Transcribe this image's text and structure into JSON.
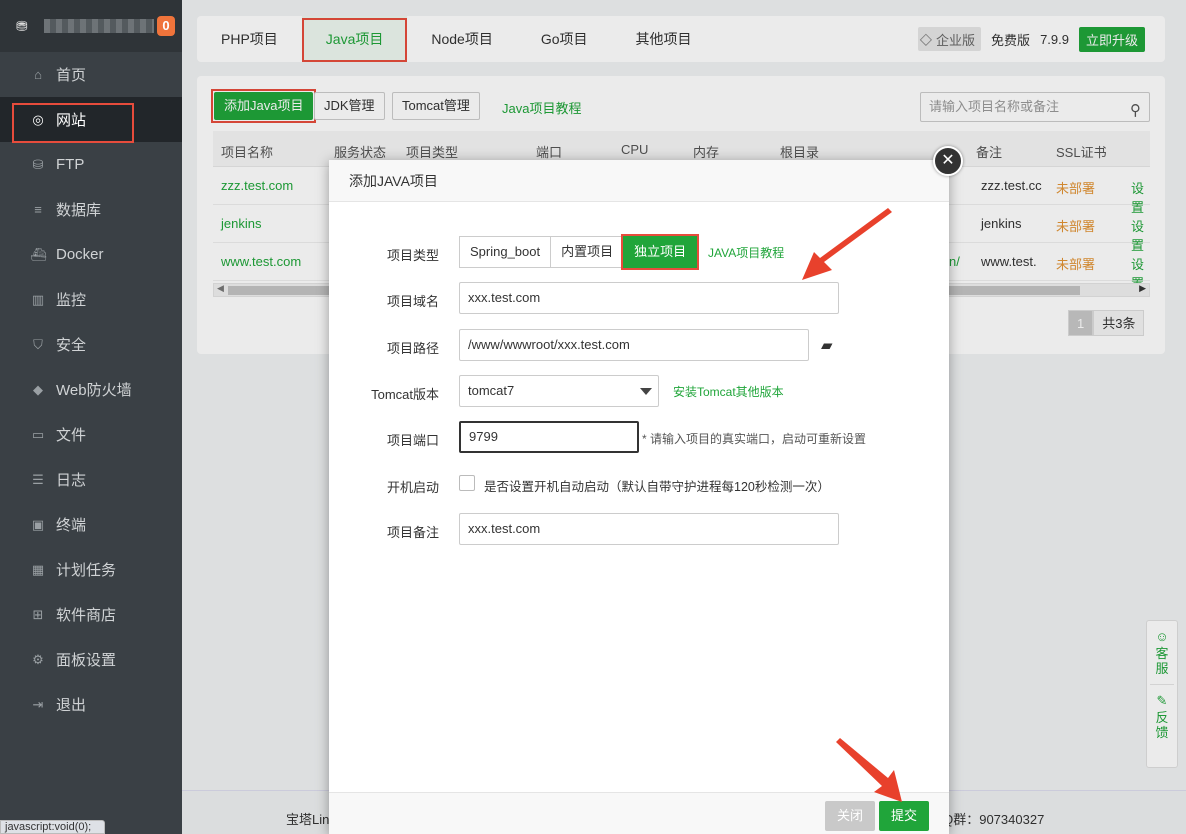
{
  "sidebar": {
    "badge": "0",
    "items": [
      {
        "label": "首页",
        "icon": "home-icon",
        "glyph": "⌂"
      },
      {
        "label": "网站",
        "icon": "globe-icon",
        "glyph": "◎"
      },
      {
        "label": "FTP",
        "icon": "ftp-icon",
        "glyph": "⛁"
      },
      {
        "label": "数据库",
        "icon": "database-icon",
        "glyph": "≡"
      },
      {
        "label": "Docker",
        "icon": "docker-icon",
        "glyph": "⛴"
      },
      {
        "label": "监控",
        "icon": "monitor-icon",
        "glyph": "▥"
      },
      {
        "label": "安全",
        "icon": "shield-icon",
        "glyph": "⛉"
      },
      {
        "label": "Web防火墙",
        "icon": "firewall-icon",
        "glyph": "◆"
      },
      {
        "label": "文件",
        "icon": "folder-icon",
        "glyph": "▭"
      },
      {
        "label": "日志",
        "icon": "log-icon",
        "glyph": "☰"
      },
      {
        "label": "终端",
        "icon": "terminal-icon",
        "glyph": "▣"
      },
      {
        "label": "计划任务",
        "icon": "calendar-icon",
        "glyph": "▦"
      },
      {
        "label": "软件商店",
        "icon": "apps-icon",
        "glyph": "⊞"
      },
      {
        "label": "面板设置",
        "icon": "gear-icon",
        "glyph": "⚙"
      },
      {
        "label": "退出",
        "icon": "logout-icon",
        "glyph": "⇥"
      }
    ]
  },
  "topbar": {
    "tabs": [
      "PHP项目",
      "Java项目",
      "Node项目",
      "Go项目",
      "其他项目"
    ],
    "edition": "企业版",
    "free": "免费版",
    "version": "7.9.9",
    "upgrade": "立即升级"
  },
  "toolbar": {
    "add": "添加Java项目",
    "jdk": "JDK管理",
    "tomcat": "Tomcat管理",
    "tutorial": "Java项目教程",
    "search_placeholder": "请输入项目名称或备注"
  },
  "table": {
    "headers": [
      "项目名称",
      "服务状态",
      "项目类型",
      "端口",
      "CPU",
      "内存",
      "根目录",
      "备注",
      "SSL证书"
    ],
    "rows": [
      {
        "name": "zzz.test.com",
        "remark": "zzz.test.cc",
        "ssl": "未部署",
        "action": "设置"
      },
      {
        "name": "jenkins",
        "remark": "jenkins",
        "ssl": "未部署",
        "action": "设置"
      },
      {
        "name": "www.test.com",
        "root_tail": "n/",
        "remark": "www.test.",
        "ssl": "未部署",
        "action": "设置"
      }
    ]
  },
  "pager": {
    "current": "1",
    "total": "共3条"
  },
  "footer": {
    "left": "宝塔Lin",
    "right": "后QQ群：907340327"
  },
  "status_bar": "javascript:void(0);",
  "float": {
    "service": "客服",
    "feedback": "反馈"
  },
  "modal": {
    "title": "添加JAVA项目",
    "type_label": "项目类型",
    "types": [
      "Spring_boot",
      "内置项目",
      "独立项目"
    ],
    "type_tutorial": "JAVA项目教程",
    "domain_label": "项目域名",
    "domain_value": "xxx.test.com",
    "path_label": "项目路径",
    "path_value": "/www/wwwroot/xxx.test.com",
    "tomcat_label": "Tomcat版本",
    "tomcat_value": "tomcat7",
    "tomcat_link": "安装Tomcat其他版本",
    "port_label": "项目端口",
    "port_value": "9799",
    "port_tip": "* 请输入项目的真实端口，启动可重新设置",
    "boot_label": "开机启动",
    "boot_text": "是否设置开机自动启动（默认自带守护进程每120秒检测一次）",
    "remark_label": "项目备注",
    "remark_value": "xxx.test.com",
    "close": "关闭",
    "submit": "提交"
  }
}
